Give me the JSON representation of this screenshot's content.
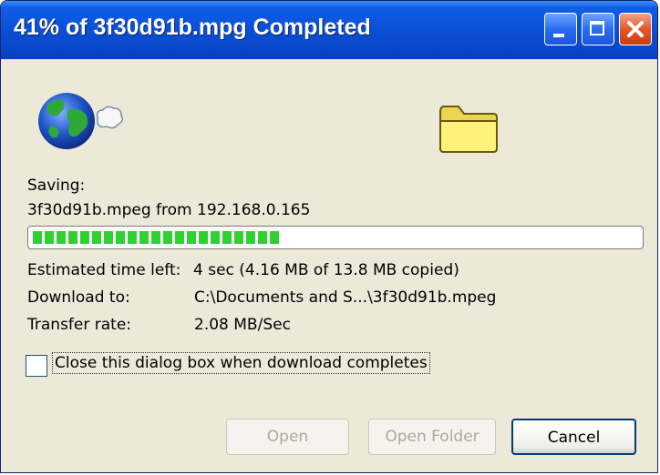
{
  "window": {
    "title": "41% of 3f30d91b.mpg Completed",
    "controls": [
      "minimize-icon",
      "maximize-icon",
      "close-icon"
    ]
  },
  "status": {
    "saving_label": "Saving:",
    "file_source": "3f30d91b.mpeg from 192.168.0.165",
    "progress_fraction": 0.41
  },
  "details": {
    "estimated_label": "Estimated time left:",
    "estimated_value": "4 sec (4.16 MB of 13.8 MB copied)",
    "download_to_label": "Download to:",
    "download_to_value": "C:\\Documents and S...\\3f30d91b.mpeg",
    "transfer_rate_label": "Transfer rate:",
    "transfer_rate_value": "2.08 MB/Sec"
  },
  "options": {
    "close_when_done_label": "Close this dialog box when download completes",
    "close_when_done_checked": false
  },
  "buttons": {
    "open": "Open",
    "open_folder": "Open Folder",
    "cancel": "Cancel"
  },
  "icons": {
    "source": "globe-icon",
    "destination": "folder-icon"
  },
  "colors": {
    "titlebar": "#0b4fd5",
    "progress": "#2fd02f",
    "dialog_bg": "#ece9d8"
  }
}
